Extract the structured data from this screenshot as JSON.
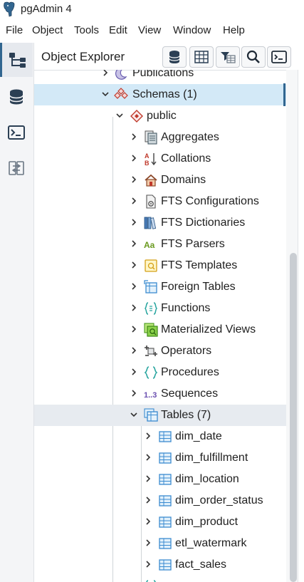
{
  "app": {
    "title": "pgAdmin 4"
  },
  "menu": [
    "File",
    "Object",
    "Tools",
    "Edit",
    "View",
    "Window",
    "Help"
  ],
  "object_explorer": {
    "title": "Object Explorer",
    "toolbar": [
      "database-icon",
      "table-grid-icon",
      "filter-rows-icon",
      "search-icon",
      "terminal-icon"
    ]
  },
  "left_toolbar": [
    "object-explorer-icon",
    "database-icon",
    "terminal-icon",
    "compare-icon"
  ],
  "tree": {
    "publications": "Publications",
    "schemas": "Schemas (1)",
    "public": "public",
    "schema_items": [
      "Aggregates",
      "Collations",
      "Domains",
      "FTS Configurations",
      "FTS Dictionaries",
      "FTS Parsers",
      "FTS Templates",
      "Foreign Tables",
      "Functions",
      "Materialized Views",
      "Operators",
      "Procedures",
      "Sequences"
    ],
    "tables": "Tables (7)",
    "table_items": [
      "dim_date",
      "dim_fulfillment",
      "dim_location",
      "dim_order_status",
      "dim_product",
      "etl_watermark",
      "fact_sales"
    ]
  },
  "colors": {
    "accent": "#326690",
    "selected": "#d3e9f7",
    "hover": "#e7ebf0"
  }
}
